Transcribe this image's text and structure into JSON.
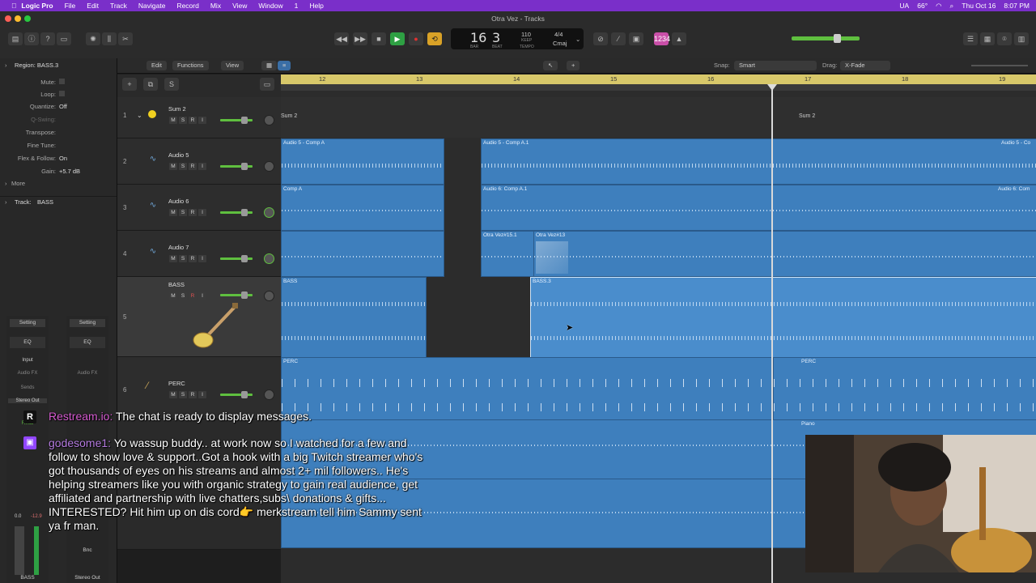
{
  "menubar": {
    "app": "Logic Pro",
    "items": [
      "File",
      "Edit",
      "Track",
      "Navigate",
      "Record",
      "Mix",
      "View",
      "Window",
      "1",
      "Help"
    ],
    "status": [
      "UA",
      "66°",
      "Thu Oct 16",
      "8:07 PM"
    ]
  },
  "window_title": "Otra Vez - Tracks",
  "lcd": {
    "bar": "16",
    "beat": "3",
    "bar_label": "BAR",
    "beat_label": "BEAT",
    "tempo": "110",
    "tempo_label": "KEEP",
    "tempo_sub": "TEMPO",
    "sig": "4/4",
    "key": "Cmaj"
  },
  "inspector": {
    "region_header": "Region: BASS.3",
    "rows": [
      {
        "label": "Mute:",
        "value": ""
      },
      {
        "label": "Loop:",
        "value": ""
      },
      {
        "label": "Quantize:",
        "value": "Off"
      },
      {
        "label": "Q-Swing:",
        "value": ""
      },
      {
        "label": "Transpose:",
        "value": ""
      },
      {
        "label": "Fine Tune:",
        "value": ""
      },
      {
        "label": "Flex & Follow:",
        "value": "On"
      },
      {
        "label": "Gain:",
        "value": "+5.7 dB"
      }
    ],
    "more": "More",
    "track_header": "Track:",
    "track_value": "BASS",
    "strip_left": {
      "setting": "Setting",
      "eq": "EQ",
      "input": "Input",
      "audio_fx": "Audio FX",
      "sends": "Sends",
      "output": "Stereo Out",
      "read": "Read",
      "val1": "0.0",
      "val2": "-12.9",
      "name": "BASS"
    },
    "strip_right": {
      "setting": "Setting",
      "eq": "EQ",
      "audio_fx": "Audio FX",
      "bnc": "Bnc",
      "name": "Stereo Out"
    }
  },
  "toolbar": {
    "edit": "Edit",
    "functions": "Functions",
    "view": "View",
    "snap_label": "Snap:",
    "snap_value": "Smart",
    "drag_label": "Drag:",
    "drag_value": "X-Fade"
  },
  "ruler": [
    "12",
    "13",
    "14",
    "15",
    "16",
    "17",
    "18",
    "19"
  ],
  "tracks": [
    {
      "num": "1",
      "name": "Sum 2"
    },
    {
      "num": "2",
      "name": "Audio 5"
    },
    {
      "num": "3",
      "name": "Audio 6"
    },
    {
      "num": "4",
      "name": "Audio 7"
    },
    {
      "num": "5",
      "name": "BASS"
    },
    {
      "num": "6",
      "name": "PERC"
    }
  ],
  "track_buttons": {
    "m": "M",
    "s": "S",
    "r": "R",
    "i": "I"
  },
  "regions": {
    "sum1": "Sum 2",
    "sum2": "Sum 2",
    "a5_1": "Audio 5 - Comp A",
    "a5_2": "Audio 5 - Comp A.1",
    "a5_3": "Audio 5 - Co",
    "a6_1": "Comp A",
    "a6_2": "Audio 6: Comp A.1",
    "a6_3": "Audio 6: Com",
    "a7_1": "Otra Vez#15.1",
    "a7_2": "Otra Vez#13",
    "bass1": "BASS",
    "bass2": "BASS.3",
    "perc1": "PERC",
    "perc2": "PERC",
    "piano": "Piano"
  },
  "chat": {
    "line1_user": "Restream.io:",
    "line1_text": " The chat is ready to display messages.",
    "line2_user": "godesome1:",
    "line2_text": " Yo wassup buddy.. at work now so I watched for a few and follow to show love & support..Got a hook with a big Twitch streamer who's got thousands of eyes on his streams and almost 2+ mil followers.. He's helping streamers like you with organic strategy to gain real audience, get affiliated and partnership with live chatters,subs\\ donations & gifts... INTERESTED? Hit him up on dis cord👉 merkstream tell him Sammy sent ya fr man."
  },
  "colors": {
    "menubar": "#7a2fc9",
    "region": "#3e7fbd",
    "ruler": "#d8c86a",
    "fader": "#5fbf3f"
  }
}
